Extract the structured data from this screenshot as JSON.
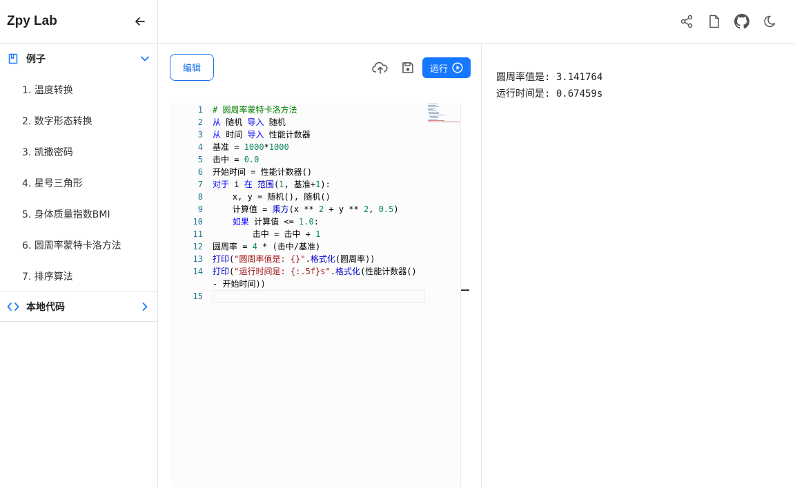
{
  "app": {
    "title": "Zpy Lab"
  },
  "sidebar": {
    "examples_label": "例子",
    "examples": [
      "1. 温度转换",
      "2. 数字形态转换",
      "3. 凯撒密码",
      "4. 星号三角形",
      "5. 身体质量指数BMI",
      "6. 圆周率蒙特卡洛方法",
      "7. 排序算法"
    ],
    "local_label": "本地代码"
  },
  "topbar": {
    "icons": [
      "share-icon",
      "file-icon",
      "github-icon",
      "moon-icon"
    ]
  },
  "editor": {
    "edit_label": "编辑",
    "run_label": "运行",
    "line_numbers": [
      "1",
      "2",
      "3",
      "4",
      "5",
      "6",
      "7",
      "8",
      "9",
      "10",
      "11",
      "12",
      "13",
      "14",
      "",
      "15"
    ],
    "code_lines": [
      "# 圆周率蒙特卡洛方法",
      "从 随机 导入 随机",
      "从 时间 导入 性能计数器",
      "基准 = 1000*1000",
      "击中 = 0.0",
      "开始时间 = 性能计数器()",
      "对于 i 在 范围(1, 基准+1):",
      "    x, y = 随机(), 随机()",
      "    计算值 = 乘方(x ** 2 + y ** 2, 0.5)",
      "    如果 计算值 <= 1.0:",
      "        击中 = 击中 + 1",
      "圆周率 = 4 * (击中/基准)",
      "打印(\"圆周率值是: {}\".格式化(圆周率))",
      "打印(\"运行时间是: {:.5f}s\".格式化(性能计数器()",
      "- 开始时间))",
      ""
    ]
  },
  "output": {
    "lines": [
      "圆周率值是: 3.141764",
      "运行时间是: 0.67459s"
    ]
  },
  "colors": {
    "accent": "#1677ff",
    "comment": "#008000",
    "keyword": "#0000ff",
    "number": "#098658",
    "string": "#a31515"
  }
}
